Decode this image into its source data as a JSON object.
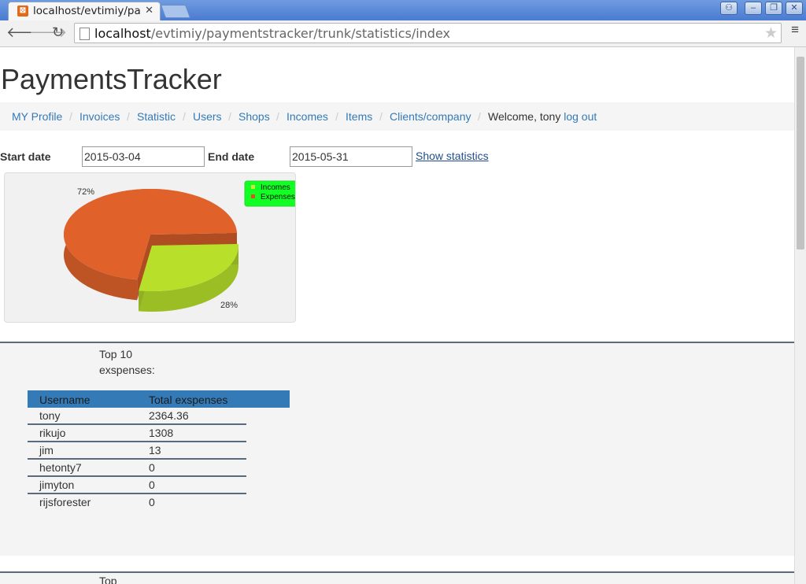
{
  "browser": {
    "tab_title": "localhost/evtimiy/pa",
    "url_host": "localhost",
    "url_path": "/evtimiy/paymentstracker/trunk/statistics/index"
  },
  "page": {
    "title": "PaymentsTracker",
    "nav": [
      "MY Profile",
      "Invoices",
      "Statistic",
      "Users",
      "Shops",
      "Incomes",
      "Items",
      "Clients/company"
    ],
    "welcome": "Welcome, tony",
    "logout": "log out"
  },
  "filter": {
    "start_label": "Start date",
    "start_value": "2015-03-04",
    "end_label": "End date",
    "end_value": "2015-05-31",
    "submit": "Show statistics"
  },
  "chart_data": {
    "type": "pie",
    "categories": [
      "Incomes",
      "Expenses"
    ],
    "values": [
      28,
      72
    ],
    "labels": [
      "28%",
      "72%"
    ],
    "colors": [
      "#b8e02b",
      "#e0622a"
    ],
    "legend_position": "top-right",
    "legend_background": "#11ff22"
  },
  "top_expenses": {
    "caption": "Top 10 exspenses:",
    "headers": [
      "Username",
      "Total exspenses"
    ],
    "rows": [
      [
        "tony",
        "2364.36"
      ],
      [
        "rikujo",
        "1308"
      ],
      [
        "jim",
        "13"
      ],
      [
        "hetonty7",
        "0"
      ],
      [
        "jimyton",
        "0"
      ],
      [
        "rijsforester",
        "0"
      ]
    ]
  },
  "second_section": {
    "caption": "Top"
  }
}
